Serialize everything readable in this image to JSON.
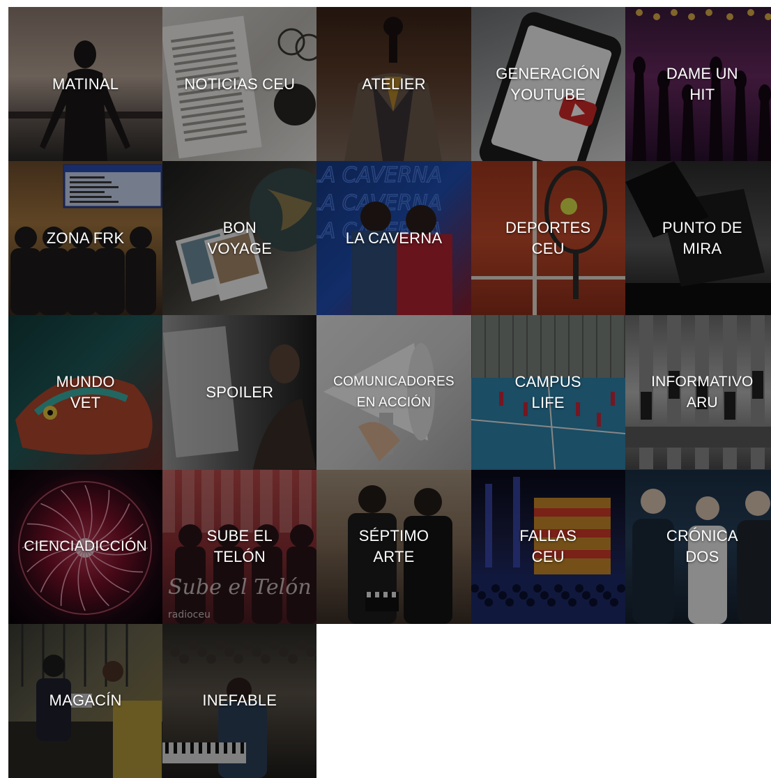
{
  "programs": [
    {
      "title": "MATINAL",
      "bg": "linear-gradient(180deg,#8c7b70 0%,#b7a597 45%,#6a5e59 70%,#2a2826 100%)",
      "art": "silhouette-man"
    },
    {
      "title": "NOTICIAS CEU",
      "bg": "linear-gradient(135deg,#d9d6d2 0%,#bebab5 50%,#e8e6e2 100%)",
      "art": "newspaper"
    },
    {
      "title": "ATELIER",
      "bg": "linear-gradient(180deg,#3a2418 0%,#5a3a28 40%,#7d6a5c 100%)",
      "art": "mannequin"
    },
    {
      "title": "GENERACIÓN\nYOUTUBE",
      "bg": "linear-gradient(160deg,#6f7274 0%,#a2a4a5 50%,#d9d9d9 100%)",
      "art": "phone"
    },
    {
      "title": "DAME UN\nHIT",
      "bg": "linear-gradient(180deg,#3b1b3c 0%,#6a2a62 45%,#2a1030 100%)",
      "art": "concert"
    },
    {
      "title": "ZONA FRK",
      "bg": "linear-gradient(180deg,#6e4d2e 0%,#a4773f 40%,#3b2c22 100%)",
      "art": "group"
    },
    {
      "title": "BON\nVOYAGE",
      "bg": "linear-gradient(135deg,#1e1e1e 0%,#3c3a35 45%,#8f8a80 100%)",
      "art": "globe"
    },
    {
      "title": "LA CAVERNA",
      "bg": "linear-gradient(135deg,#163a86 0%,#1f4fb4 50%,#8a1d2a 100%)",
      "art": "caverna"
    },
    {
      "title": "DEPORTES\nCEU",
      "bg": "linear-gradient(180deg,#a4391f 0%,#c44a2b 50%,#8e2f1a 100%)",
      "art": "tennis"
    },
    {
      "title": "PUNTO DE\nMIRA",
      "bg": "linear-gradient(180deg,#2c2c2c 0%,#5a5a5a 55%,#111111 100%)",
      "art": "ballot"
    },
    {
      "title": "MUNDO\nVET",
      "bg": "linear-gradient(135deg,#123a3a 0%,#1f5b5a 45%,#6a2a26 100%)",
      "art": "chameleon"
    },
    {
      "title": "SPOILER",
      "bg": "linear-gradient(90deg,#9b9b9b 0%,#5a5a5a 45%,#1b1b1b 100%)",
      "art": "spoiler"
    },
    {
      "title": "COMUNICADORES\nEN ACCIÓN",
      "bg": "linear-gradient(135deg,#e4e4e4 0%,#cfcfcf 55%,#a8a8a8 100%)",
      "art": "megaphone",
      "size": "small"
    },
    {
      "title": "CAMPUS\nLIFE",
      "bg": "linear-gradient(180deg,#5d6b5f 0%,#7f8c80 35%,#2a8fb2 55%,#2d7ea1 100%)",
      "art": "court"
    },
    {
      "title": "INFORMATIVO\nARU",
      "bg": "linear-gradient(180deg,#6f6f6f 0%,#b9b9b9 50%,#4a4a4a 100%)",
      "art": "mixer",
      "size": "medium"
    },
    {
      "title": "CIENCIADICCIÓN",
      "bg": "radial-gradient(circle at 50% 50%,#c13a56 0%,#7a1028 35%,#1a0812 70%,#050205 100%)",
      "art": "plasma",
      "size": "medium"
    },
    {
      "title": "SUBE EL\nTELÓN",
      "bg": "linear-gradient(180deg,#b94848 0%,#8c2f34 50%,#4a1c22 100%)",
      "art": "telon"
    },
    {
      "title": "SÉPTIMO\nARTE",
      "bg": "linear-gradient(180deg,#a79580 0%,#866f5a 45%,#3a2e26 100%)",
      "art": "duo"
    },
    {
      "title": "FALLAS\nCEU",
      "bg": "linear-gradient(180deg,#090a1a 0%,#1b1f45 45%,#1c2c70 75%,#0d1440 100%)",
      "art": "fallas"
    },
    {
      "title": "CRÓNICA\nDOS",
      "bg": "linear-gradient(180deg,#1b2f44 0%,#27415c 45%,#15202d 100%)",
      "art": "trio"
    },
    {
      "title": "MAGACÍN",
      "bg": "linear-gradient(135deg,#3b3b34 0%,#6a6650 45%,#8d7a3e 100%)",
      "art": "studio"
    },
    {
      "title": "INEFABLE",
      "bg": "linear-gradient(180deg,#2b2a26 0%,#5a5248 45%,#1f1d1a 100%)",
      "art": "stage"
    }
  ]
}
